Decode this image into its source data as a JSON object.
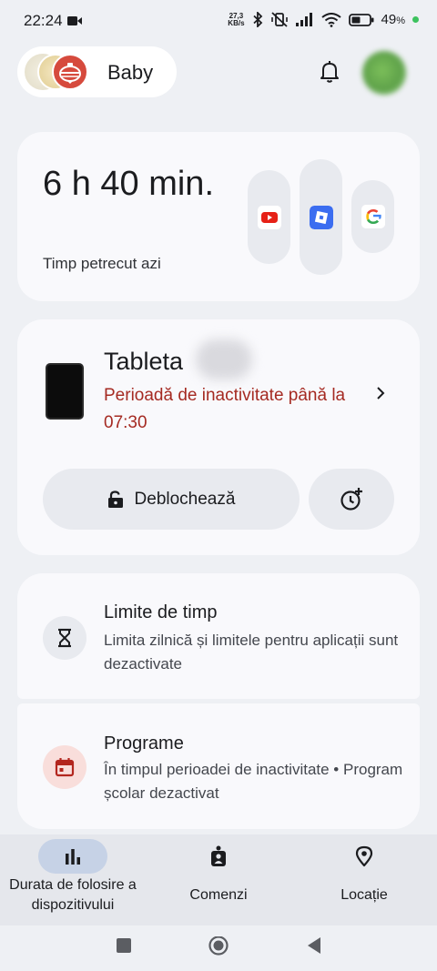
{
  "status_bar": {
    "time": "22:24",
    "net_speed_value": "27,3",
    "net_speed_unit": "KB/s",
    "battery": "49",
    "battery_unit": "%"
  },
  "header": {
    "profile_name": "Baby"
  },
  "usage": {
    "value": "6 h 40 min.",
    "label": "Timp petrecut azi",
    "apps": [
      "youtube-icon",
      "roblox-icon",
      "google-icon"
    ]
  },
  "device": {
    "name": "Tableta",
    "status": "Perioadă de inactivitate până la 07:30",
    "unlock_label": "Deblochează"
  },
  "limits": {
    "title": "Limite de timp",
    "subtitle": "Limita zilnică și limitele pentru aplicații sunt dezactivate"
  },
  "schedules": {
    "title": "Programe",
    "subtitle": "În timpul perioadei de inactivitate • Program școlar dezactivat"
  },
  "bottom_nav": {
    "items": [
      {
        "label": "Durata de folosire a dispozitivului",
        "active": true
      },
      {
        "label": "Comenzi",
        "active": false
      },
      {
        "label": "Locație",
        "active": false
      }
    ]
  },
  "colors": {
    "accent_red": "#a52a22",
    "active_nav": "#c6d2e6",
    "background": "#eef0f4"
  }
}
